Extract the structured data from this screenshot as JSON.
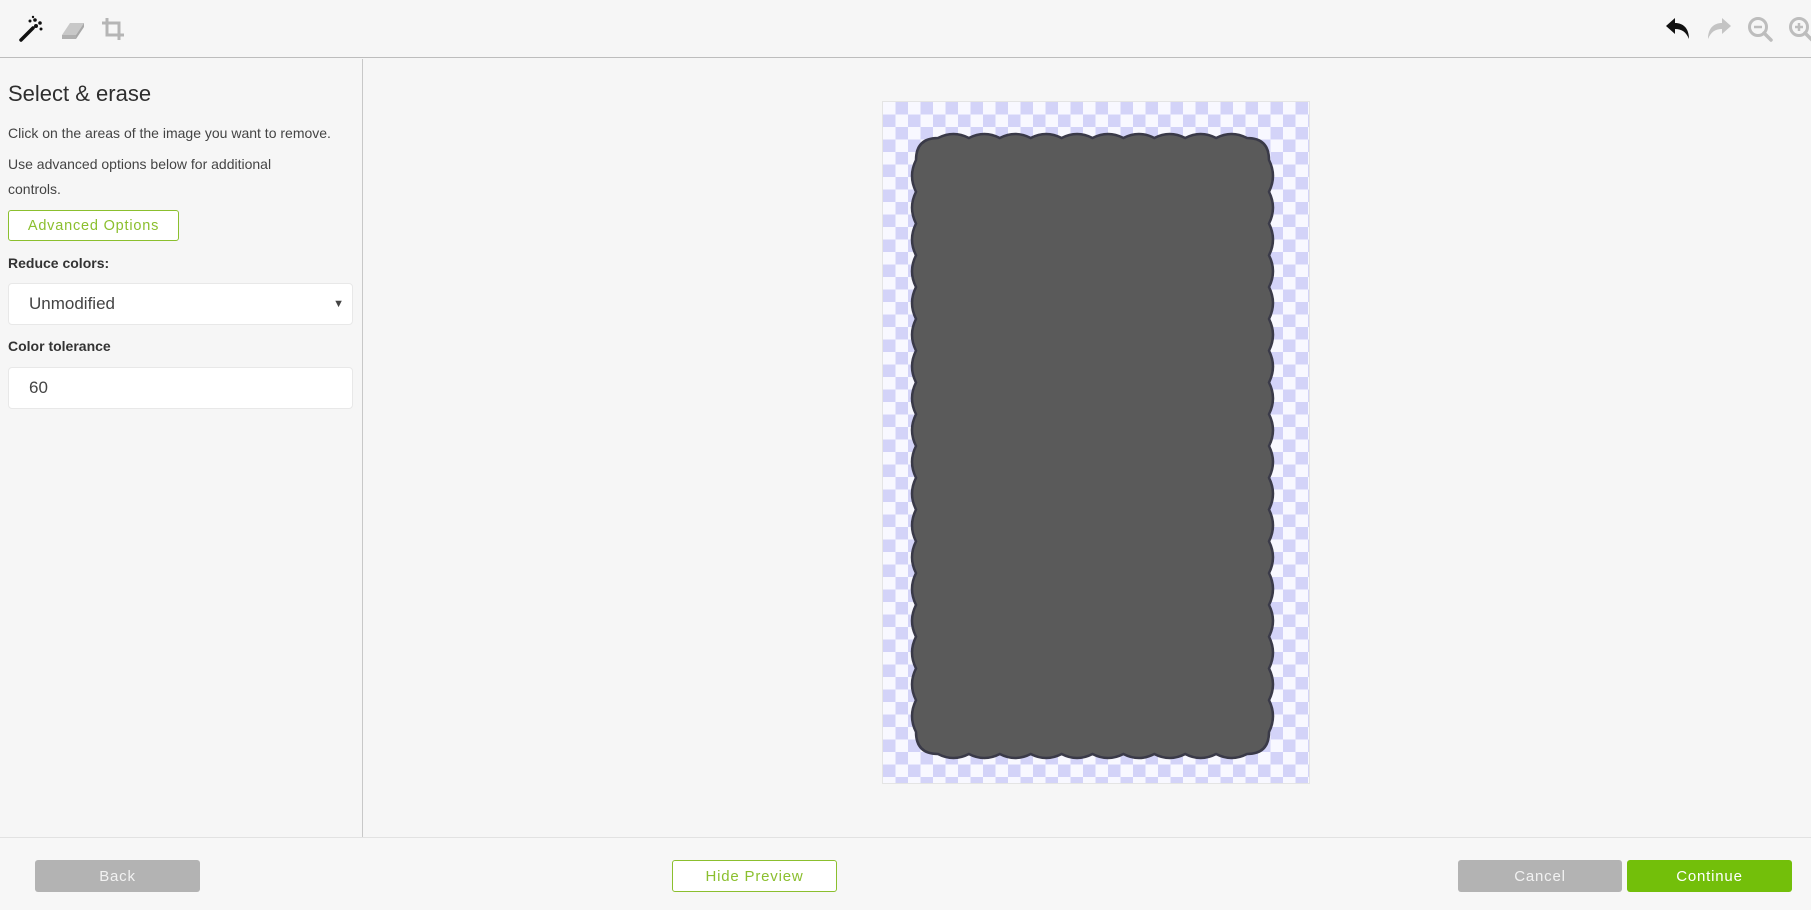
{
  "toolbar": {
    "left_tools": [
      {
        "icon": "magic-wand-icon",
        "label": "Select & erase",
        "active": true
      },
      {
        "icon": "eraser-icon",
        "label": "Erase",
        "active": false
      },
      {
        "icon": "crop-icon",
        "label": "Crop",
        "active": false
      }
    ],
    "right_tools": [
      {
        "icon": "undo-icon",
        "label": "Undo",
        "enabled": true
      },
      {
        "icon": "redo-icon",
        "label": "Redo",
        "enabled": false
      },
      {
        "icon": "zoom-out-icon",
        "label": "Zoom out",
        "enabled": false
      },
      {
        "icon": "zoom-in-icon",
        "label": "Zoom in",
        "enabled": false
      }
    ]
  },
  "sidebar": {
    "title": "Select & erase",
    "instruction": "Click on the areas of the image you want to remove.",
    "hint": "Use advanced options below for additional controls.",
    "advanced_button": "Advanced Options",
    "reduce_colors": {
      "label": "Reduce colors:",
      "selected": "Unmodified"
    },
    "color_tolerance": {
      "label": "Color tolerance",
      "value": "60"
    }
  },
  "canvas": {
    "shape": "scalloped-rectangle",
    "shape_fill": "#5a5a5a",
    "shape_stroke": "#3a3a48",
    "checker_colors": [
      "#d3d3f8",
      "#f8f8ff"
    ]
  },
  "footer": {
    "back": "Back",
    "hide_preview": "Hide Preview",
    "cancel": "Cancel",
    "continue": "Continue"
  },
  "colors": {
    "accent_green": "#73bf0a",
    "outline_green": "#8bbf2e",
    "disabled_grey": "#b3b3b3"
  }
}
